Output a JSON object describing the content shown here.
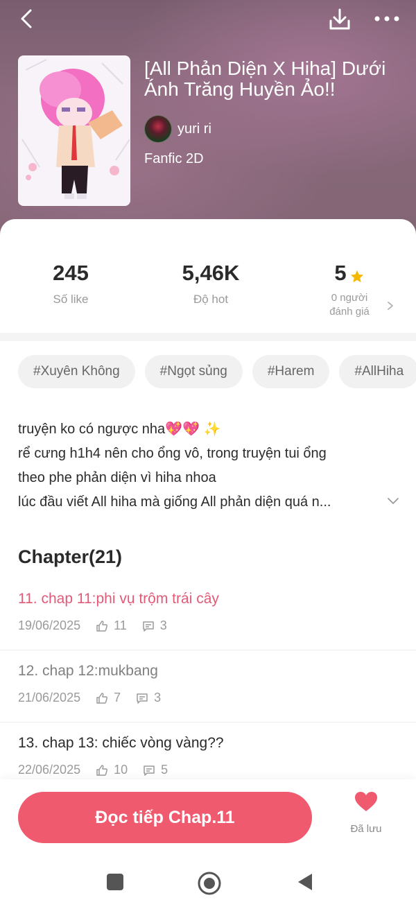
{
  "header": {
    "title": "[All Phản Diện X Hiha] Dưới Ánh Trăng Huyền Ảo!!",
    "author": "yuri ri",
    "genre": "Fanfic 2D"
  },
  "stats": [
    {
      "value": "245",
      "label": "Số like"
    },
    {
      "value": "5,46K",
      "label": "Độ hot"
    },
    {
      "value": "5",
      "label_line1": "0 người",
      "label_line2": "đánh giá"
    }
  ],
  "tags": [
    "#Xuyên Không",
    "#Ngọt sủng",
    "#Harem",
    "#AllHiha"
  ],
  "description": {
    "line1": "truyện ko có ngược nha",
    "line1_emoji": "💖💖 ✨",
    "line2": "rể cưng h1h4 nên cho ổng vô, trong truyện tui ổng",
    "line3": "theo phe phản diện vì hiha nhoa",
    "line4": "lúc đầu viết All hiha mà giống All phản diện quá n..."
  },
  "chapters_header": "Chapter(21)",
  "chapters": [
    {
      "title": "11. chap 11:phi vụ trộm trái cây",
      "date": "19/06/2025",
      "likes": "11",
      "comments": "3",
      "state": "active"
    },
    {
      "title": "12. chap 12:mukbang",
      "date": "21/06/2025",
      "likes": "7",
      "comments": "3",
      "state": "read"
    },
    {
      "title": "13. chap 13: chiếc vòng vàng??",
      "date": "22/06/2025",
      "likes": "10",
      "comments": "5",
      "state": "normal"
    }
  ],
  "bottom": {
    "read_button": "Đọc tiếp Chap.11",
    "saved_label": "Đã lưu"
  },
  "colors": {
    "accent": "#f05a6f",
    "active_chapter": "#e15a78",
    "star": "#f5b800"
  }
}
